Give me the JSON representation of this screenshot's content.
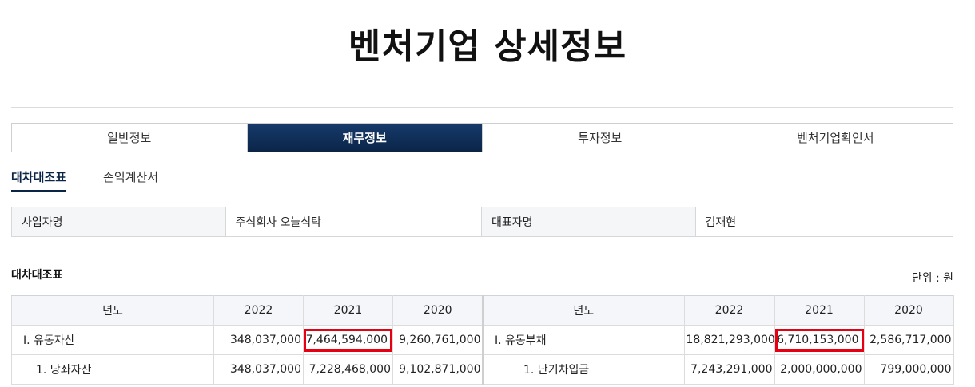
{
  "page": {
    "title": "벤처기업 상세정보"
  },
  "main_tabs": [
    {
      "label": "일반정보",
      "active": false
    },
    {
      "label": "재무정보",
      "active": true
    },
    {
      "label": "투자정보",
      "active": false
    },
    {
      "label": "벤처기업확인서",
      "active": false
    }
  ],
  "sub_tabs": [
    {
      "label": "대차대조표",
      "active": true
    },
    {
      "label": "손익계산서",
      "active": false
    }
  ],
  "info": {
    "company_label": "사업자명",
    "company_value": "주식회사 오늘식탁",
    "ceo_label": "대표자명",
    "ceo_value": "김재현"
  },
  "section": {
    "title": "대차대조표",
    "unit": "단위 : 원"
  },
  "assets": {
    "headers": [
      "년도",
      "2022",
      "2021",
      "2020"
    ],
    "rows": [
      {
        "item": "Ⅰ. 유동자산",
        "v2022": "348,037,000",
        "v2021": "7,464,594,000",
        "v2020": "9,260,761,000"
      },
      {
        "item": "1. 당좌자산",
        "v2022": "348,037,000",
        "v2021": "7,228,468,000",
        "v2020": "9,102,871,000"
      }
    ]
  },
  "liabilities": {
    "headers": [
      "년도",
      "2022",
      "2021",
      "2020"
    ],
    "rows": [
      {
        "item": "Ⅰ. 유동부채",
        "v2022": "18,821,293,000",
        "v2021": "6,710,153,000",
        "v2020": "2,586,717,000"
      },
      {
        "item": "1. 단기차입금",
        "v2022": "7,243,291,000",
        "v2021": "2,000,000,000",
        "v2020": "799,000,000"
      }
    ]
  },
  "colors": {
    "accent_navy": "#0b2547",
    "highlight_red": "#e60012"
  }
}
